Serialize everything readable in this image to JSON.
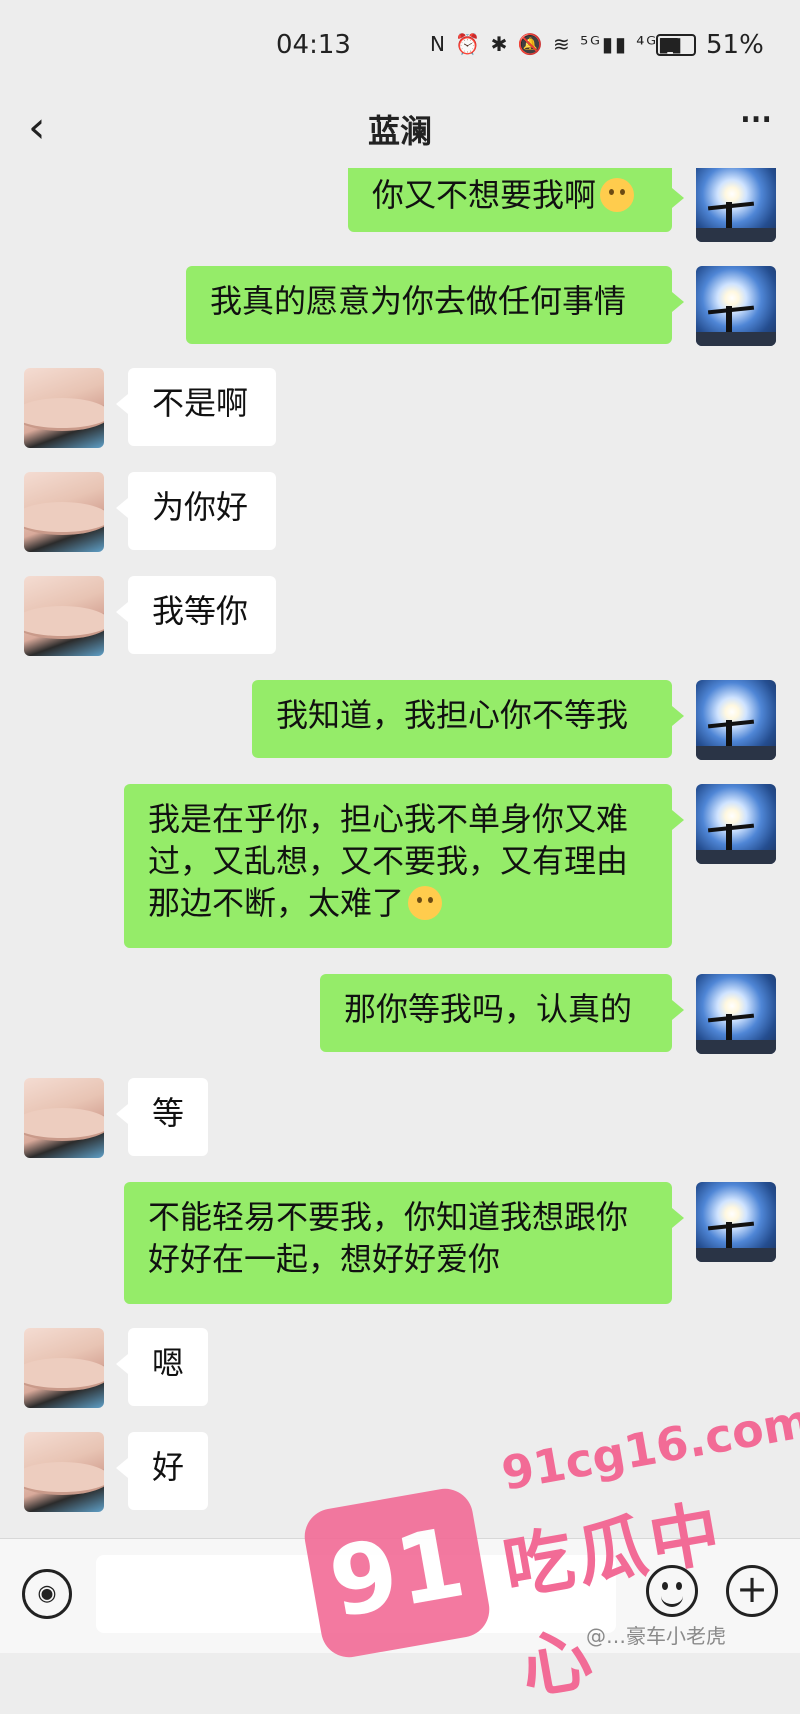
{
  "status_bar": {
    "time": "04:13",
    "icons": "N ⏰ ✱ 🔕 ≋ ⁵ᴳ▮▮ ⁴ᴳ▮▮",
    "battery_level": 0.51,
    "battery_text": "51%"
  },
  "nav": {
    "back_icon": "chevron-left",
    "title": "蓝澜",
    "more_icon": "ellipsis"
  },
  "messages": [
    {
      "side": "me",
      "text": "你又不想要我啊",
      "emoji": true
    },
    {
      "side": "me",
      "text": "我真的愿意为你去做任何事情"
    },
    {
      "side": "her",
      "text": "不是啊"
    },
    {
      "side": "her",
      "text": "为你好"
    },
    {
      "side": "her",
      "text": "我等你"
    },
    {
      "side": "me",
      "text": "我知道，我担心你不等我"
    },
    {
      "side": "me",
      "text": "我是在乎你，担心我不单身你又难过，又乱想，又不要我，又有理由那边不断，太难了",
      "emoji": true
    },
    {
      "side": "me",
      "text": "那你等我吗，认真的"
    },
    {
      "side": "her",
      "text": "等"
    },
    {
      "side": "me",
      "text": "不能轻易不要我，你知道我想跟你好好在一起，想好好爱你"
    },
    {
      "side": "her",
      "text": "嗯"
    },
    {
      "side": "her",
      "text": "好"
    }
  ],
  "bottom_bar": {
    "voice_icon": "voice-icon",
    "emoji_icon": "emoji-icon",
    "plus_icon": "plus-icon"
  },
  "watermark": {
    "badge": "91",
    "url": "91cg16.com",
    "name": "吃瓜中心",
    "credit": "@…豪车小老虎"
  },
  "colors": {
    "me_bubble": "#95ec69",
    "her_bubble": "#ffffff",
    "background": "#ededed",
    "watermark": "#f26b96"
  }
}
